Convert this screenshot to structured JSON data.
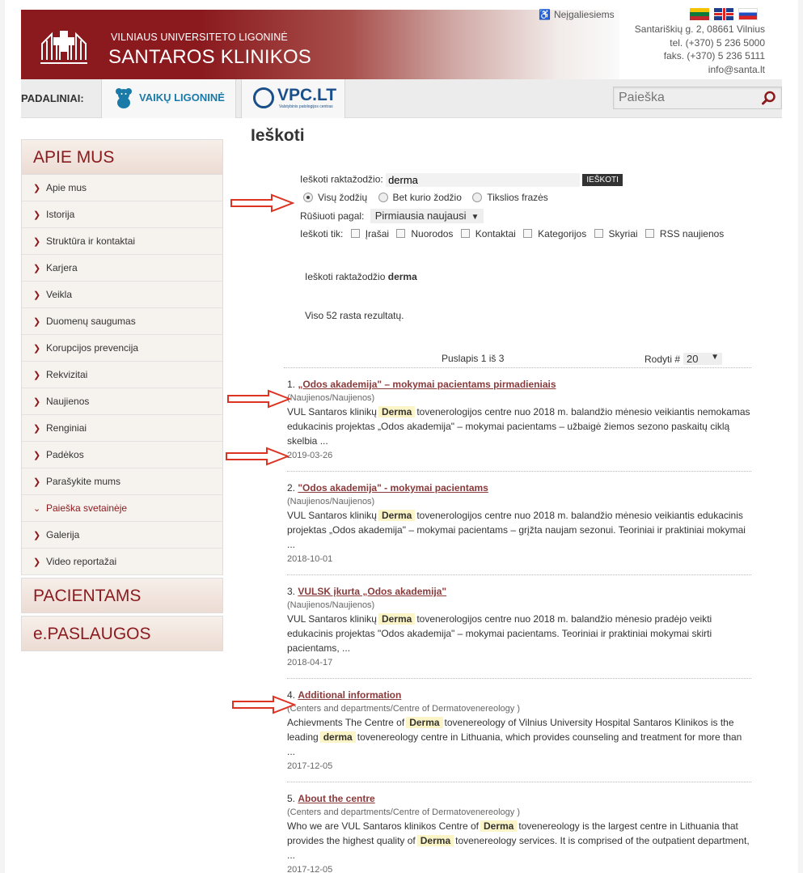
{
  "header": {
    "university": "VILNIAUS UNIVERSITETO LIGONINĖ",
    "name": "SANTAROS KLINIKOS",
    "accessibility": "Neįgaliesiems",
    "contact": [
      "Santariškių g. 2, 08661 Vilnius",
      "tel. (+370) 5 236 5000",
      "faks. (+370) 5 236 5111",
      "info@santa.lt"
    ]
  },
  "subnav": {
    "label": "PADALINIAI:",
    "unit1": "VAIKŲ LIGONINĖ",
    "unit2": "VPC.LT",
    "unit2_sub": "Valstybinis patologijos centras",
    "search_placeholder": "Paieška"
  },
  "sidebar": {
    "section1": "APIE MUS",
    "items": [
      {
        "label": "Apie mus"
      },
      {
        "label": "Istorija"
      },
      {
        "label": "Struktūra ir kontaktai"
      },
      {
        "label": "Karjera"
      },
      {
        "label": "Veikla"
      },
      {
        "label": "Duomenų saugumas"
      },
      {
        "label": "Korupcijos prevencija"
      },
      {
        "label": "Rekvizitai"
      },
      {
        "label": "Naujienos"
      },
      {
        "label": "Renginiai"
      },
      {
        "label": "Padėkos"
      },
      {
        "label": "Parašykite mums"
      },
      {
        "label": "Paieška svetainėje"
      },
      {
        "label": "Galerija"
      },
      {
        "label": "Video reportažai"
      }
    ],
    "section2": "PACIENTAMS",
    "section3": "e.PASLAUGOS"
  },
  "main": {
    "title": "Ieškoti",
    "keyword_label": "Ieškoti raktažodžio:",
    "keyword_value": "derma",
    "search_button": "IEŠKOTI",
    "radio_all": "Visų žodžių",
    "radio_any": "Bet kurio žodžio",
    "radio_exact": "Tikslios frazės",
    "sort_label": "Rūšiuoti pagal:",
    "sort_value": "Pirmiausia naujausi",
    "only_label": "Ieškoti tik:",
    "only_options": [
      "Įrašai",
      "Nuorodos",
      "Kontaktai",
      "Kategorijos",
      "Skyriai",
      "RSS naujienos"
    ],
    "summary_prefix": "Ieškoti raktažodžio",
    "summary_keyword": "derma",
    "total": "Viso 52 rasta rezultatų.",
    "page_info": "Puslapis 1 iš 3",
    "show_label": "Rodyti #",
    "show_value": "20"
  },
  "results": [
    {
      "num": "1.",
      "title": "„Odos akademija\" – mokymai pacientams pirmadieniais",
      "category": "(Naujienos/Naujienos)",
      "pre": "VUL Santaros klinikų",
      "hl": "Derma",
      "post": "tovenerologijos centre nuo 2018 m. balandžio mėnesio veikiantis nemokamas edukacinis projektas „Odos akademija\" – mokymai pacientams – užbaigė žiemos sezono paskaitų ciklą skelbia ...",
      "date": "2019-03-26"
    },
    {
      "num": "2.",
      "title": "\"Odos akademija\" - mokymai pacientams",
      "category": "(Naujienos/Naujienos)",
      "pre": "VUL Santaros klinikų",
      "hl": "Derma",
      "post": "tovenerologijos centre nuo 2018 m. balandžio mėnesio veikiantis edukacinis projektas „Odos akademija\" – mokymai pacientams – grįžta naujam sezonui. Teoriniai ir praktiniai mokymai ...",
      "date": "2018-10-01"
    },
    {
      "num": "3.",
      "title": "VULSK įkurta „Odos akademija\"",
      "category": "(Naujienos/Naujienos)",
      "pre": "VUL Santaros klinikų",
      "hl": "Derma",
      "post": "tovenerologijos centre nuo 2018 m. balandžio mėnesio pradėjo veikti edukacinis projektas \"Odos akademija\" – mokymai pacientams. Teoriniai ir praktiniai mokymai skirti pacientams, ...",
      "date": "2018-04-17"
    },
    {
      "num": "4.",
      "title": "Additional information",
      "category": "(Centers and departments/Centre of Dermatovenereology )",
      "pre": "Achievments The Centre of",
      "hl": "Derma",
      "mid": "tovenereology of Vilnius University Hospital Santaros Klinikos is the leading",
      "hl2": "derma",
      "post": "tovenereology centre in Lithuania, which provides counseling and treatment for more than ...",
      "date": "2017-12-05"
    },
    {
      "num": "5.",
      "title": "About the centre",
      "category": "(Centers and departments/Centre of Dermatovenereology )",
      "pre": "Who we are VUL Santaros klinikos Centre of",
      "hl": "Derma",
      "mid": "tovenereology is the largest centre in Lithuania that provides the highest quality of",
      "hl2": "Derma",
      "post": "tovenereology services. It is comprised of the outpatient department, ...",
      "date": "2017-12-05"
    }
  ]
}
